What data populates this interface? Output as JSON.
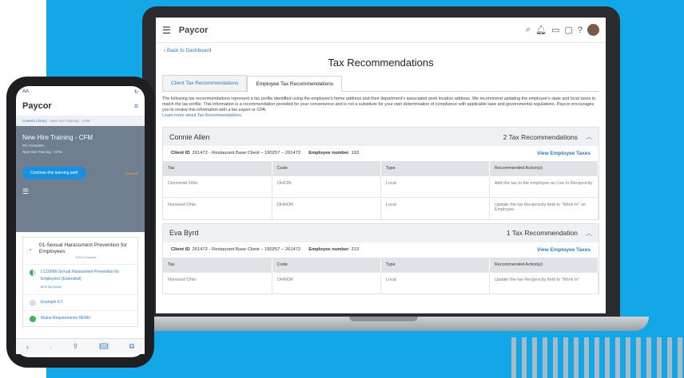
{
  "laptop": {
    "brand": "Paycor",
    "back_link": "Back to Dashboard",
    "page_title": "Tax Recommendations",
    "tabs": [
      "Client Tax Recommendations",
      "Employee Tax Recommendations"
    ],
    "description": "The following tax recommendations represent a tax profile identified using the employee's home address and their department's associated work location address. We recommend updating the employee's state and local taxes to match the tax profile. This information is a recommendation provided for your convenience and is not a substitute for your own determination of compliance with applicable laws and governmental regulations. Paycor encourages you to review this information with a tax expert or CPA.",
    "learn_more": "Learn more about Tax Recommendations.",
    "table_headers": [
      "Tax",
      "Code",
      "Type",
      "Recommended Action(s)"
    ],
    "employees": [
      {
        "name": "Connie Allen",
        "count": "2 Tax Recommendations",
        "client_id_label": "Client ID",
        "client_id": "261472 - Restaurant Base Client – 190257 – 261472",
        "emp_label": "Employee number",
        "emp_number": "193",
        "view_link": "View Employee Taxes",
        "rows": [
          [
            "Cincinnati Ohio",
            "OHCIN",
            "Local",
            "Add the tax to the employee as Live In Reciprocity"
          ],
          [
            "Norwood Ohio",
            "OHNOR",
            "Local",
            "Update the tax Reciprocity field to \"Work In\" on Employee"
          ]
        ]
      },
      {
        "name": "Eva Byrd",
        "count": "1 Tax Recommendation",
        "client_id_label": "Client ID",
        "client_id": "261472 - Restaurant Base Client – 190257 – 261472",
        "emp_label": "Employee number",
        "emp_number": "213",
        "view_link": "View Employee Taxes",
        "rows": [
          [
            "Norwood Ohio",
            "OHNOR",
            "Local",
            "Update the tax Reciprocity field to \"Work In\""
          ]
        ]
      }
    ]
  },
  "phone": {
    "status_left": "AA",
    "status_right": "↻",
    "brand": "Paycor",
    "breadcrumb_a": "Content Library",
    "breadcrumb_b": "New Hire Training - CFM",
    "hero_title": "New Hire Training - CFM",
    "hero_progress": "0% Complete",
    "hero_sub": "New Hire Training - CFM",
    "continue_label": "Continue this learning path",
    "enroll_label": "Unenroll",
    "module_title": "01-Sexual Harassment Prevention for Employees",
    "module_progress": "10% Complete",
    "items": [
      {
        "label": "LC10066-Sexual Harassment Prevention for Employees (Extended)",
        "sub": "60% My Score",
        "color": "#3cb55a"
      },
      {
        "label": "Example ILT",
        "sub": "",
        "color": "#d9dde1"
      },
      {
        "label": "Maine Requirements HERE!",
        "sub": "",
        "color": "#3cb55a"
      }
    ]
  }
}
